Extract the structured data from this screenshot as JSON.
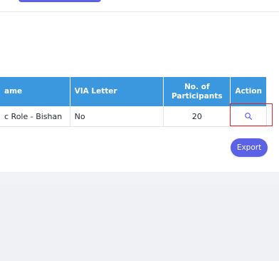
{
  "table": {
    "headers": {
      "name": "ame",
      "via_letter": "VIA Letter",
      "participants": "No. of Participants",
      "action": "Action"
    },
    "rows": [
      {
        "name": "c Role - Bishan",
        "via_letter": "No",
        "participants": "20",
        "action_icon": "search-icon"
      }
    ]
  },
  "export": {
    "label": "Export"
  },
  "colors": {
    "header_bg": "#3b97de",
    "primary_button": "#5b62e6",
    "highlight_border": "#d9262b"
  }
}
